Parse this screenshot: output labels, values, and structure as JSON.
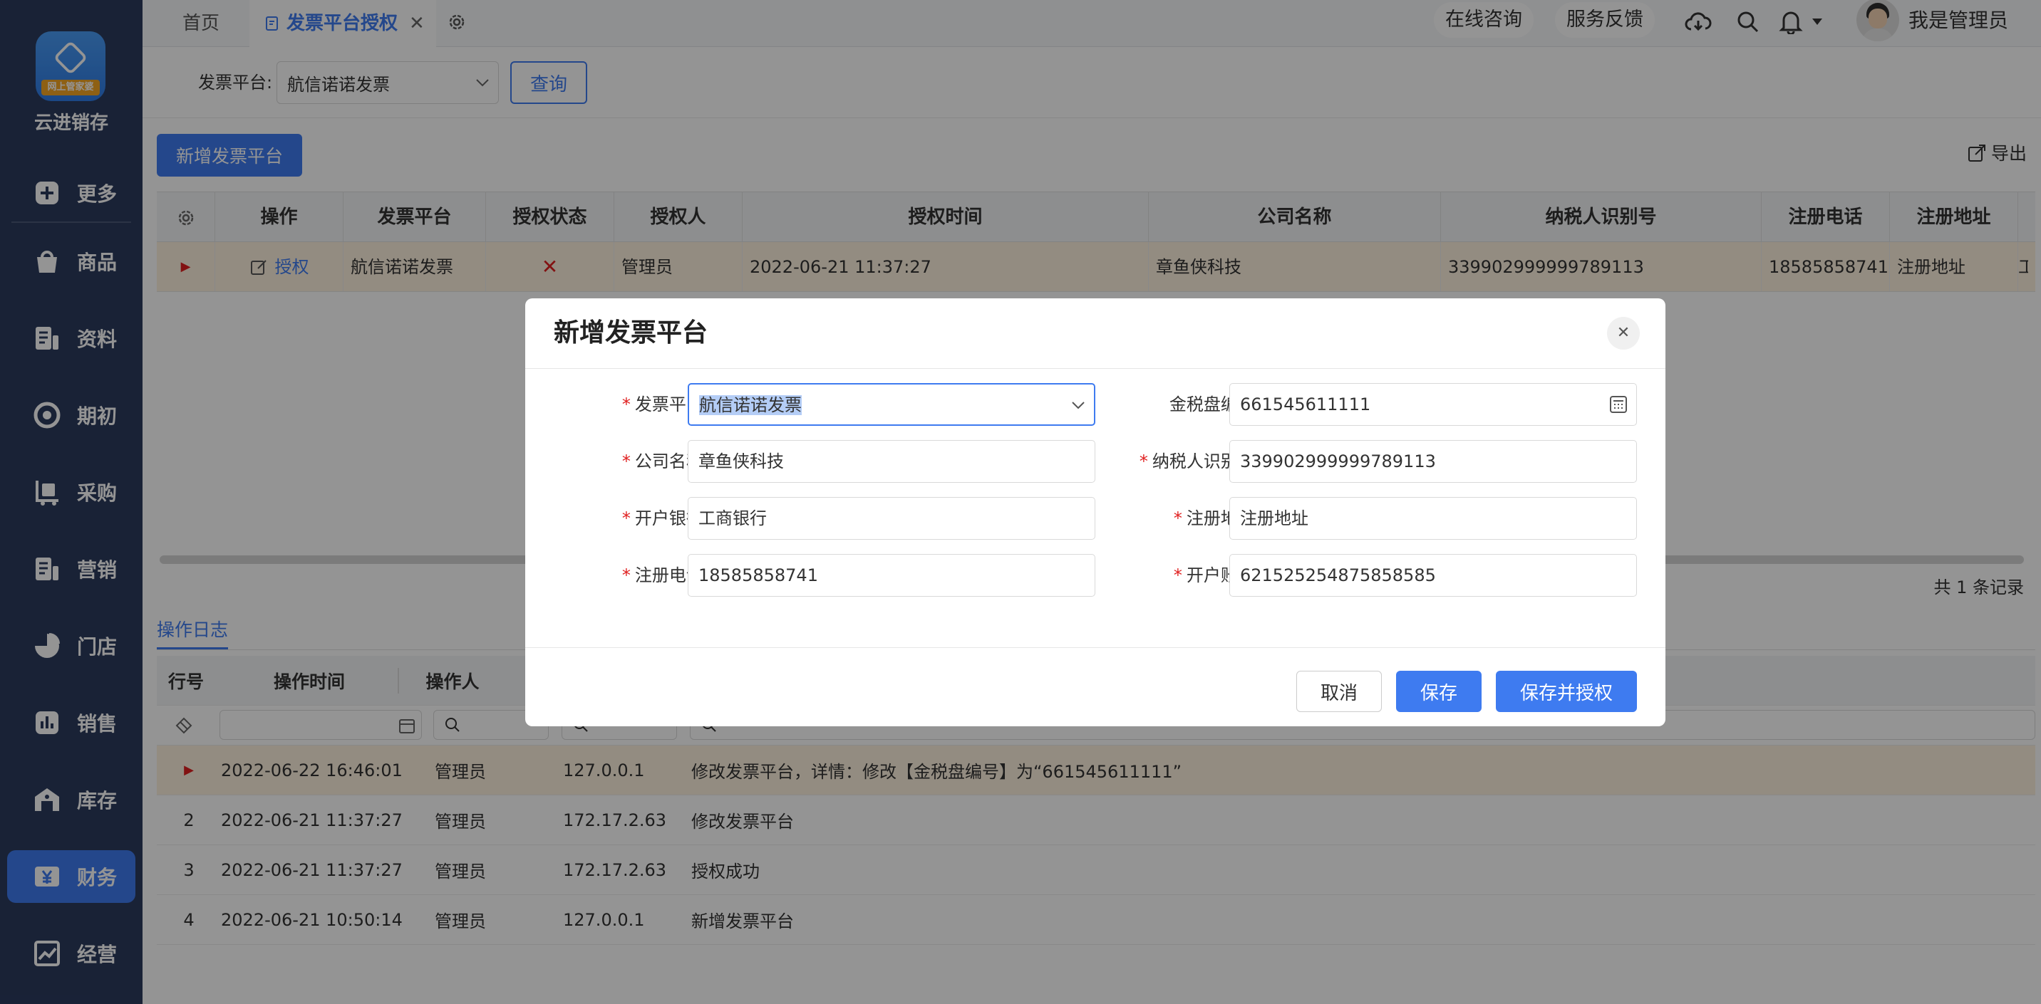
{
  "app": {
    "name": "云进销存",
    "logo_tag": "网上管家婆"
  },
  "sidebar": {
    "items": [
      {
        "label": "更多",
        "icon": "plus-square-icon"
      },
      {
        "label": "商品",
        "icon": "bag-icon"
      },
      {
        "label": "资料",
        "icon": "document-icon"
      },
      {
        "label": "期初",
        "icon": "target-icon"
      },
      {
        "label": "采购",
        "icon": "cart-icon"
      },
      {
        "label": "营销",
        "icon": "list-icon"
      },
      {
        "label": "门店",
        "icon": "pie-icon"
      },
      {
        "label": "销售",
        "icon": "bar-chart-icon"
      },
      {
        "label": "库存",
        "icon": "warehouse-icon"
      },
      {
        "label": "财务",
        "icon": "yen-icon",
        "active": true
      },
      {
        "label": "经营",
        "icon": "trend-icon"
      }
    ]
  },
  "topbar": {
    "home_tab": "首页",
    "active_tab": "发票平台授权",
    "consult": "在线咨询",
    "feedback": "服务反馈",
    "user": "我是管理员"
  },
  "filter": {
    "label": "发票平台:",
    "value": "航信诺诺发票",
    "query_button": "查询"
  },
  "toolbar": {
    "add_button": "新增发票平台",
    "export": "导出"
  },
  "grid": {
    "columns": [
      "操作",
      "发票平台",
      "授权状态",
      "授权人",
      "授权时间",
      "公司名称",
      "纳税人识别号",
      "注册电话",
      "注册地址"
    ],
    "row": {
      "action": "授权",
      "platform": "航信诺诺发票",
      "status": "✕",
      "authorizer": "管理员",
      "time": "2022-06-21 11:37:27",
      "company": "章鱼侠科技",
      "tax_id": "339902999999789113",
      "phone": "18585858741",
      "address": "注册地址",
      "extra": "工"
    },
    "total": "共 1 条记录"
  },
  "log": {
    "tab": "操作日志",
    "columns": [
      "行号",
      "操作时间",
      "操作人"
    ],
    "rows": [
      {
        "no": "",
        "time": "2022-06-22 16:46:01",
        "user": "管理员",
        "ip": "127.0.0.1",
        "content": "修改发票平台，详情：修改【金税盘编号】为“661545611111”"
      },
      {
        "no": "2",
        "time": "2022-06-21 11:37:27",
        "user": "管理员",
        "ip": "172.17.2.63",
        "content": "修改发票平台"
      },
      {
        "no": "3",
        "time": "2022-06-21 11:37:27",
        "user": "管理员",
        "ip": "172.17.2.63",
        "content": "授权成功"
      },
      {
        "no": "4",
        "time": "2022-06-21 10:50:14",
        "user": "管理员",
        "ip": "127.0.0.1",
        "content": "新增发票平台"
      }
    ]
  },
  "modal": {
    "title": "新增发票平台",
    "fields": {
      "platform": {
        "label": "发票平台:",
        "value": "航信诺诺发票"
      },
      "disk_no": {
        "label": "金税盘编号:",
        "value": "661545611111"
      },
      "company": {
        "label": "公司名称:",
        "value": "章鱼侠科技"
      },
      "tax_id": {
        "label": "纳税人识别号:",
        "value": "339902999999789113"
      },
      "bank": {
        "label": "开户银行:",
        "value": "工商银行"
      },
      "address": {
        "label": "注册地址:",
        "value": "注册地址"
      },
      "phone": {
        "label": "注册电话:",
        "value": "18585858741"
      },
      "account": {
        "label": "开户账号:",
        "value": "621525254875858585"
      }
    },
    "cancel": "取消",
    "save": "保存",
    "save_auth": "保存并授权"
  },
  "colors": {
    "accent": "#3e7bf0",
    "sidebar": "#2b3b5e",
    "required": "#e02020",
    "row_highlight": "#fdf1df"
  }
}
